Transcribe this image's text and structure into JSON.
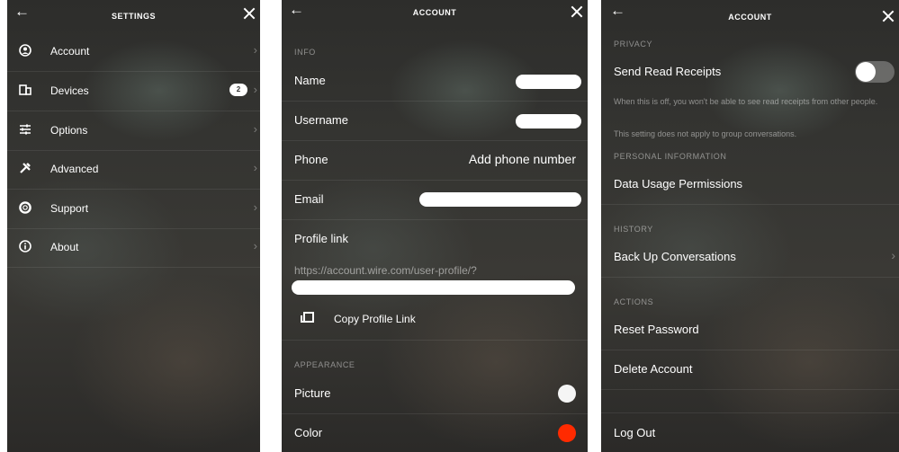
{
  "settings": {
    "title": "SETTINGS",
    "items": [
      {
        "label": "Account",
        "icon": "account-icon"
      },
      {
        "label": "Devices",
        "icon": "devices-icon",
        "badge": "2"
      },
      {
        "label": "Options",
        "icon": "options-icon"
      },
      {
        "label": "Advanced",
        "icon": "advanced-icon"
      },
      {
        "label": "Support",
        "icon": "support-icon"
      },
      {
        "label": "About",
        "icon": "about-icon"
      }
    ]
  },
  "account": {
    "title": "ACCOUNT",
    "info_header": "INFO",
    "name_label": "Name",
    "username_label": "Username",
    "phone_label": "Phone",
    "phone_value": "Add phone number",
    "email_label": "Email",
    "profile_link_label": "Profile link",
    "profile_link_url": "https://account.wire.com/user-profile/?",
    "copy_label": "Copy Profile Link",
    "appearance_header": "APPEARANCE",
    "picture_label": "Picture",
    "color_label": "Color",
    "color_value": "#ff2a00"
  },
  "account2": {
    "title": "ACCOUNT",
    "privacy_header": "PRIVACY",
    "read_receipts_label": "Send Read Receipts",
    "read_receipts_enabled": false,
    "note1": "When this is off, you won't be able to see read receipts from other people.",
    "note2": "This setting does not apply to group conversations.",
    "personal_header": "PERSONAL INFORMATION",
    "data_usage_label": "Data Usage Permissions",
    "history_header": "HISTORY",
    "backup_label": "Back Up Conversations",
    "actions_header": "ACTIONS",
    "reset_label": "Reset Password",
    "delete_label": "Delete Account",
    "logout_label": "Log Out"
  }
}
